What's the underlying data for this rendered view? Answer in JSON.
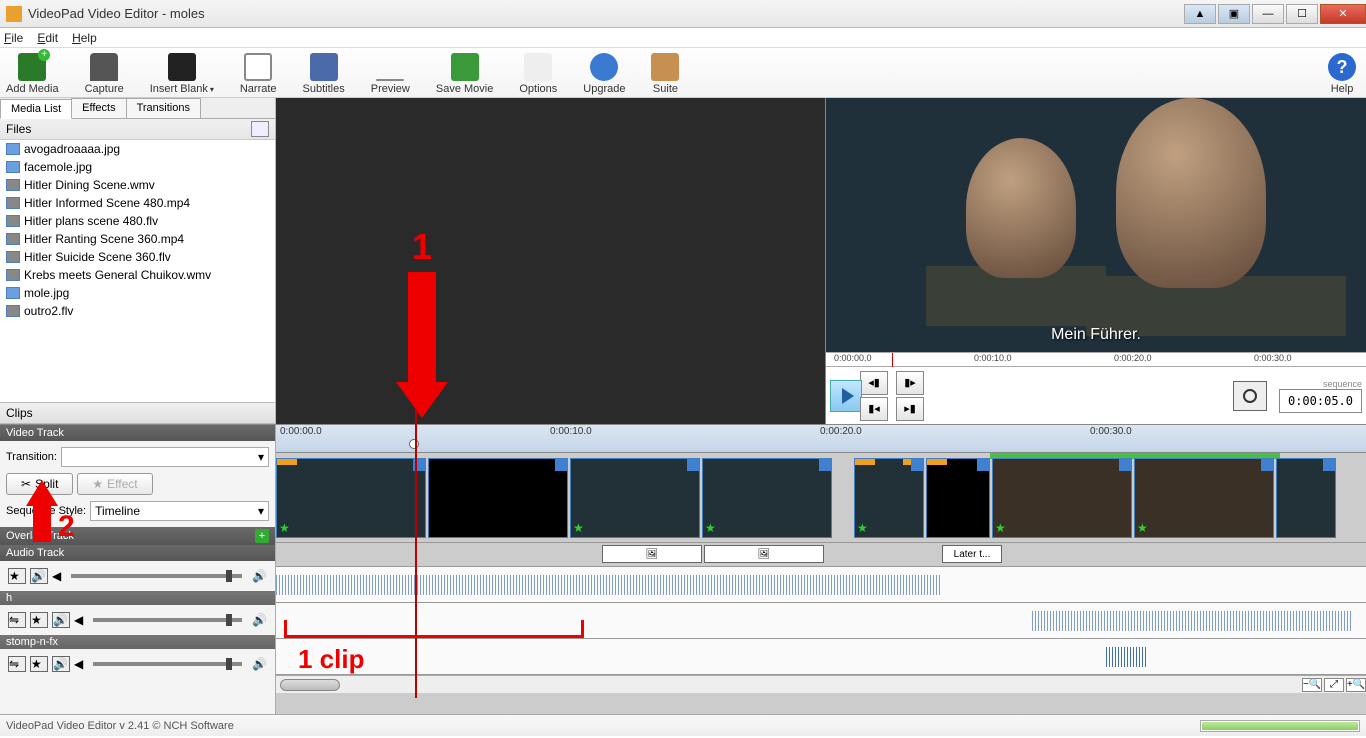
{
  "window": {
    "title": "VideoPad Video Editor - moles"
  },
  "menu": {
    "file": "File",
    "edit": "Edit",
    "help": "Help"
  },
  "toolbar": {
    "add": "Add Media",
    "capture": "Capture",
    "blank": "Insert Blank",
    "narrate": "Narrate",
    "subtitles": "Subtitles",
    "preview": "Preview",
    "save": "Save Movie",
    "options": "Options",
    "upgrade": "Upgrade",
    "suite": "Suite",
    "help": "Help"
  },
  "tabs": {
    "media": "Media List",
    "effects": "Effects",
    "transitions": "Transitions"
  },
  "files": {
    "header": "Files",
    "items": [
      "avogadroaaaa.jpg",
      "facemole.jpg",
      "Hitler Dining Scene.wmv",
      "Hitler Informed Scene 480.mp4",
      "Hitler plans scene 480.flv",
      "Hitler Ranting Scene 360.mp4",
      "Hitler Suicide Scene 360.flv",
      "Krebs meets General Chuikov.wmv",
      "mole.jpg",
      "outro2.flv"
    ]
  },
  "clips_header": "Clips",
  "left_tracks": {
    "video": "Video Track",
    "transition_label": "Transition:",
    "split": "Split",
    "effect": "Effect",
    "seqstyle_label": "Sequence Style:",
    "seqstyle_value": "Timeline",
    "overlay": "Overlay Track",
    "audio": "Audio Track",
    "sub1": "h",
    "sub2": "stomp-n-fx"
  },
  "preview": {
    "subtitle": "Mein Führer.",
    "ruler_ticks": [
      "0:00:00.0",
      "0:00:10.0",
      "0:00:20.0",
      "0:00:30.0"
    ],
    "sequence_label": "sequence",
    "timecode": "0:00:05.0"
  },
  "timeline": {
    "ruler_ticks": [
      "0:00:00.0",
      "0:00:10.0",
      "0:00:20.0",
      "0:00:30.0"
    ],
    "overlay_text": "Later t..."
  },
  "status": "VideoPad Video Editor v 2.41 © NCH Software",
  "annotations": {
    "one": "1",
    "two": "2",
    "clip": "1 clip"
  }
}
